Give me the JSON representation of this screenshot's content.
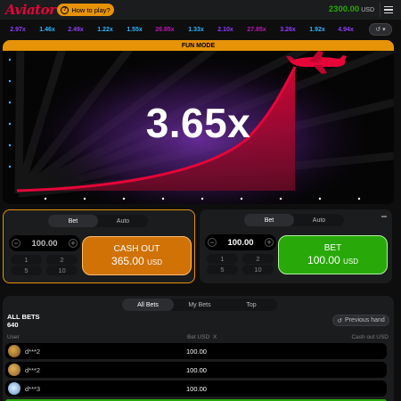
{
  "header": {
    "logo": "Aviator",
    "how_to_play": "How to play?",
    "balance": "2300.00",
    "currency": "USD"
  },
  "multipliers": [
    {
      "value": "2.97x",
      "color": "#913ef8"
    },
    {
      "value": "1.46x",
      "color": "#34b4ff"
    },
    {
      "value": "2.49x",
      "color": "#913ef8"
    },
    {
      "value": "1.22x",
      "color": "#34b4ff"
    },
    {
      "value": "1.55x",
      "color": "#34b4ff"
    },
    {
      "value": "26.85x",
      "color": "#c017b4"
    },
    {
      "value": "1.33x",
      "color": "#34b4ff"
    },
    {
      "value": "2.10x",
      "color": "#913ef8"
    },
    {
      "value": "27.85x",
      "color": "#c017b4"
    },
    {
      "value": "3.26x",
      "color": "#913ef8"
    },
    {
      "value": "1.92x",
      "color": "#34b4ff"
    },
    {
      "value": "4.94x",
      "color": "#913ef8"
    }
  ],
  "game": {
    "mode_banner": "FUN MODE",
    "multiplier": "3.65x"
  },
  "bet_panel_1": {
    "tabs": [
      "Bet",
      "Auto"
    ],
    "amount": "100.00",
    "quick": [
      "1",
      "2",
      "5",
      "10"
    ],
    "button_line1": "CASH OUT",
    "button_amount": "365.00",
    "button_currency": "USD"
  },
  "bet_panel_2": {
    "tabs": [
      "Bet",
      "Auto"
    ],
    "amount": "100.00",
    "quick": [
      "1",
      "2",
      "5",
      "10"
    ],
    "button_line1": "BET",
    "button_amount": "100.00",
    "button_currency": "USD"
  },
  "bets": {
    "tabs": [
      "All Bets",
      "My Bets",
      "Top"
    ],
    "title": "ALL BETS",
    "count": "640",
    "previous_hand": "Previous hand",
    "columns": {
      "user": "User",
      "bet": "Bet USD",
      "x": "X",
      "cashout": "Cash out USD"
    },
    "rows": [
      {
        "user": "d***2",
        "bet": "100.00"
      },
      {
        "user": "d***2",
        "bet": "100.00"
      },
      {
        "user": "d***3",
        "bet": "100.00"
      }
    ]
  },
  "colors": {
    "accent_red": "#e50539",
    "orange": "#d07206",
    "green": "#28a909"
  }
}
